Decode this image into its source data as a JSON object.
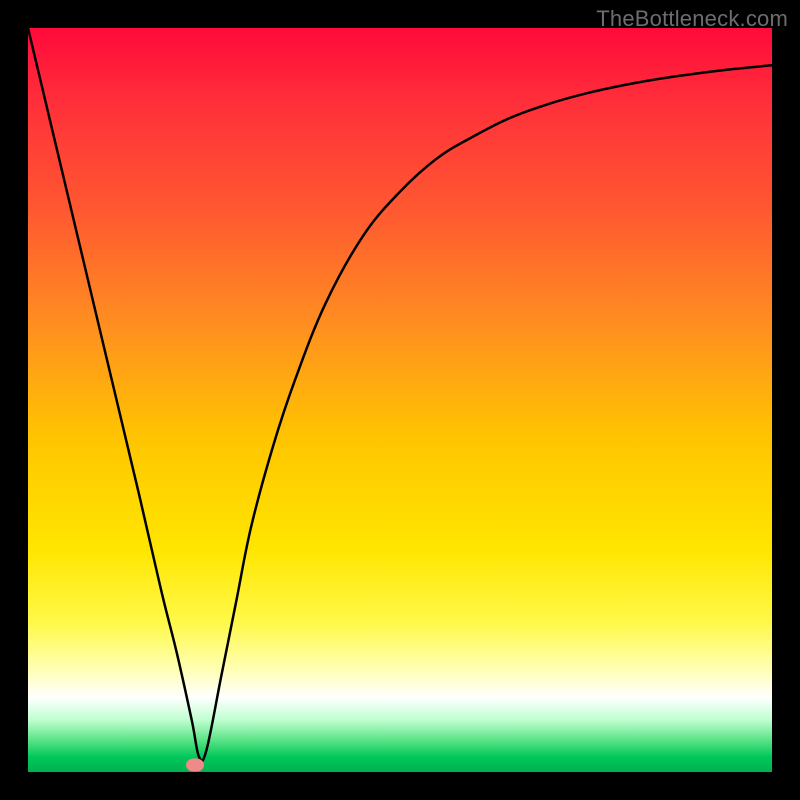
{
  "attribution": "TheBottleneck.com",
  "marker": {
    "x_pct": 22.5,
    "y_pct": 99.0
  },
  "chart_data": {
    "type": "line",
    "title": "",
    "xlabel": "",
    "ylabel": "",
    "xlim": [
      0,
      100
    ],
    "ylim": [
      0,
      100
    ],
    "series": [
      {
        "name": "bottleneck-curve",
        "x": [
          0,
          5,
          10,
          15,
          18,
          20,
          22,
          23,
          24,
          26,
          28,
          30,
          33,
          36,
          40,
          45,
          50,
          55,
          60,
          65,
          70,
          75,
          80,
          85,
          90,
          95,
          100
        ],
        "y": [
          100,
          79,
          58,
          37,
          24,
          16,
          7,
          2,
          3,
          13,
          23,
          33,
          44,
          53,
          63,
          72,
          78,
          82.5,
          85.5,
          88,
          89.8,
          91.2,
          92.3,
          93.2,
          93.9,
          94.5,
          95
        ]
      }
    ],
    "background_gradient": {
      "stops": [
        {
          "pos": 0,
          "color": "#ff0a3a"
        },
        {
          "pos": 10,
          "color": "#ff2f3a"
        },
        {
          "pos": 25,
          "color": "#ff5a30"
        },
        {
          "pos": 40,
          "color": "#ff8f20"
        },
        {
          "pos": 55,
          "color": "#ffc400"
        },
        {
          "pos": 70,
          "color": "#ffe600"
        },
        {
          "pos": 80,
          "color": "#fff94a"
        },
        {
          "pos": 86,
          "color": "#ffffb0"
        },
        {
          "pos": 90,
          "color": "#ffffff"
        },
        {
          "pos": 93,
          "color": "#bfffcf"
        },
        {
          "pos": 96,
          "color": "#50e080"
        },
        {
          "pos": 98,
          "color": "#00c85a"
        },
        {
          "pos": 100,
          "color": "#00b050"
        }
      ]
    },
    "marker_point": {
      "x": 22.5,
      "y": 1.0,
      "color": "#f08a8a"
    }
  }
}
